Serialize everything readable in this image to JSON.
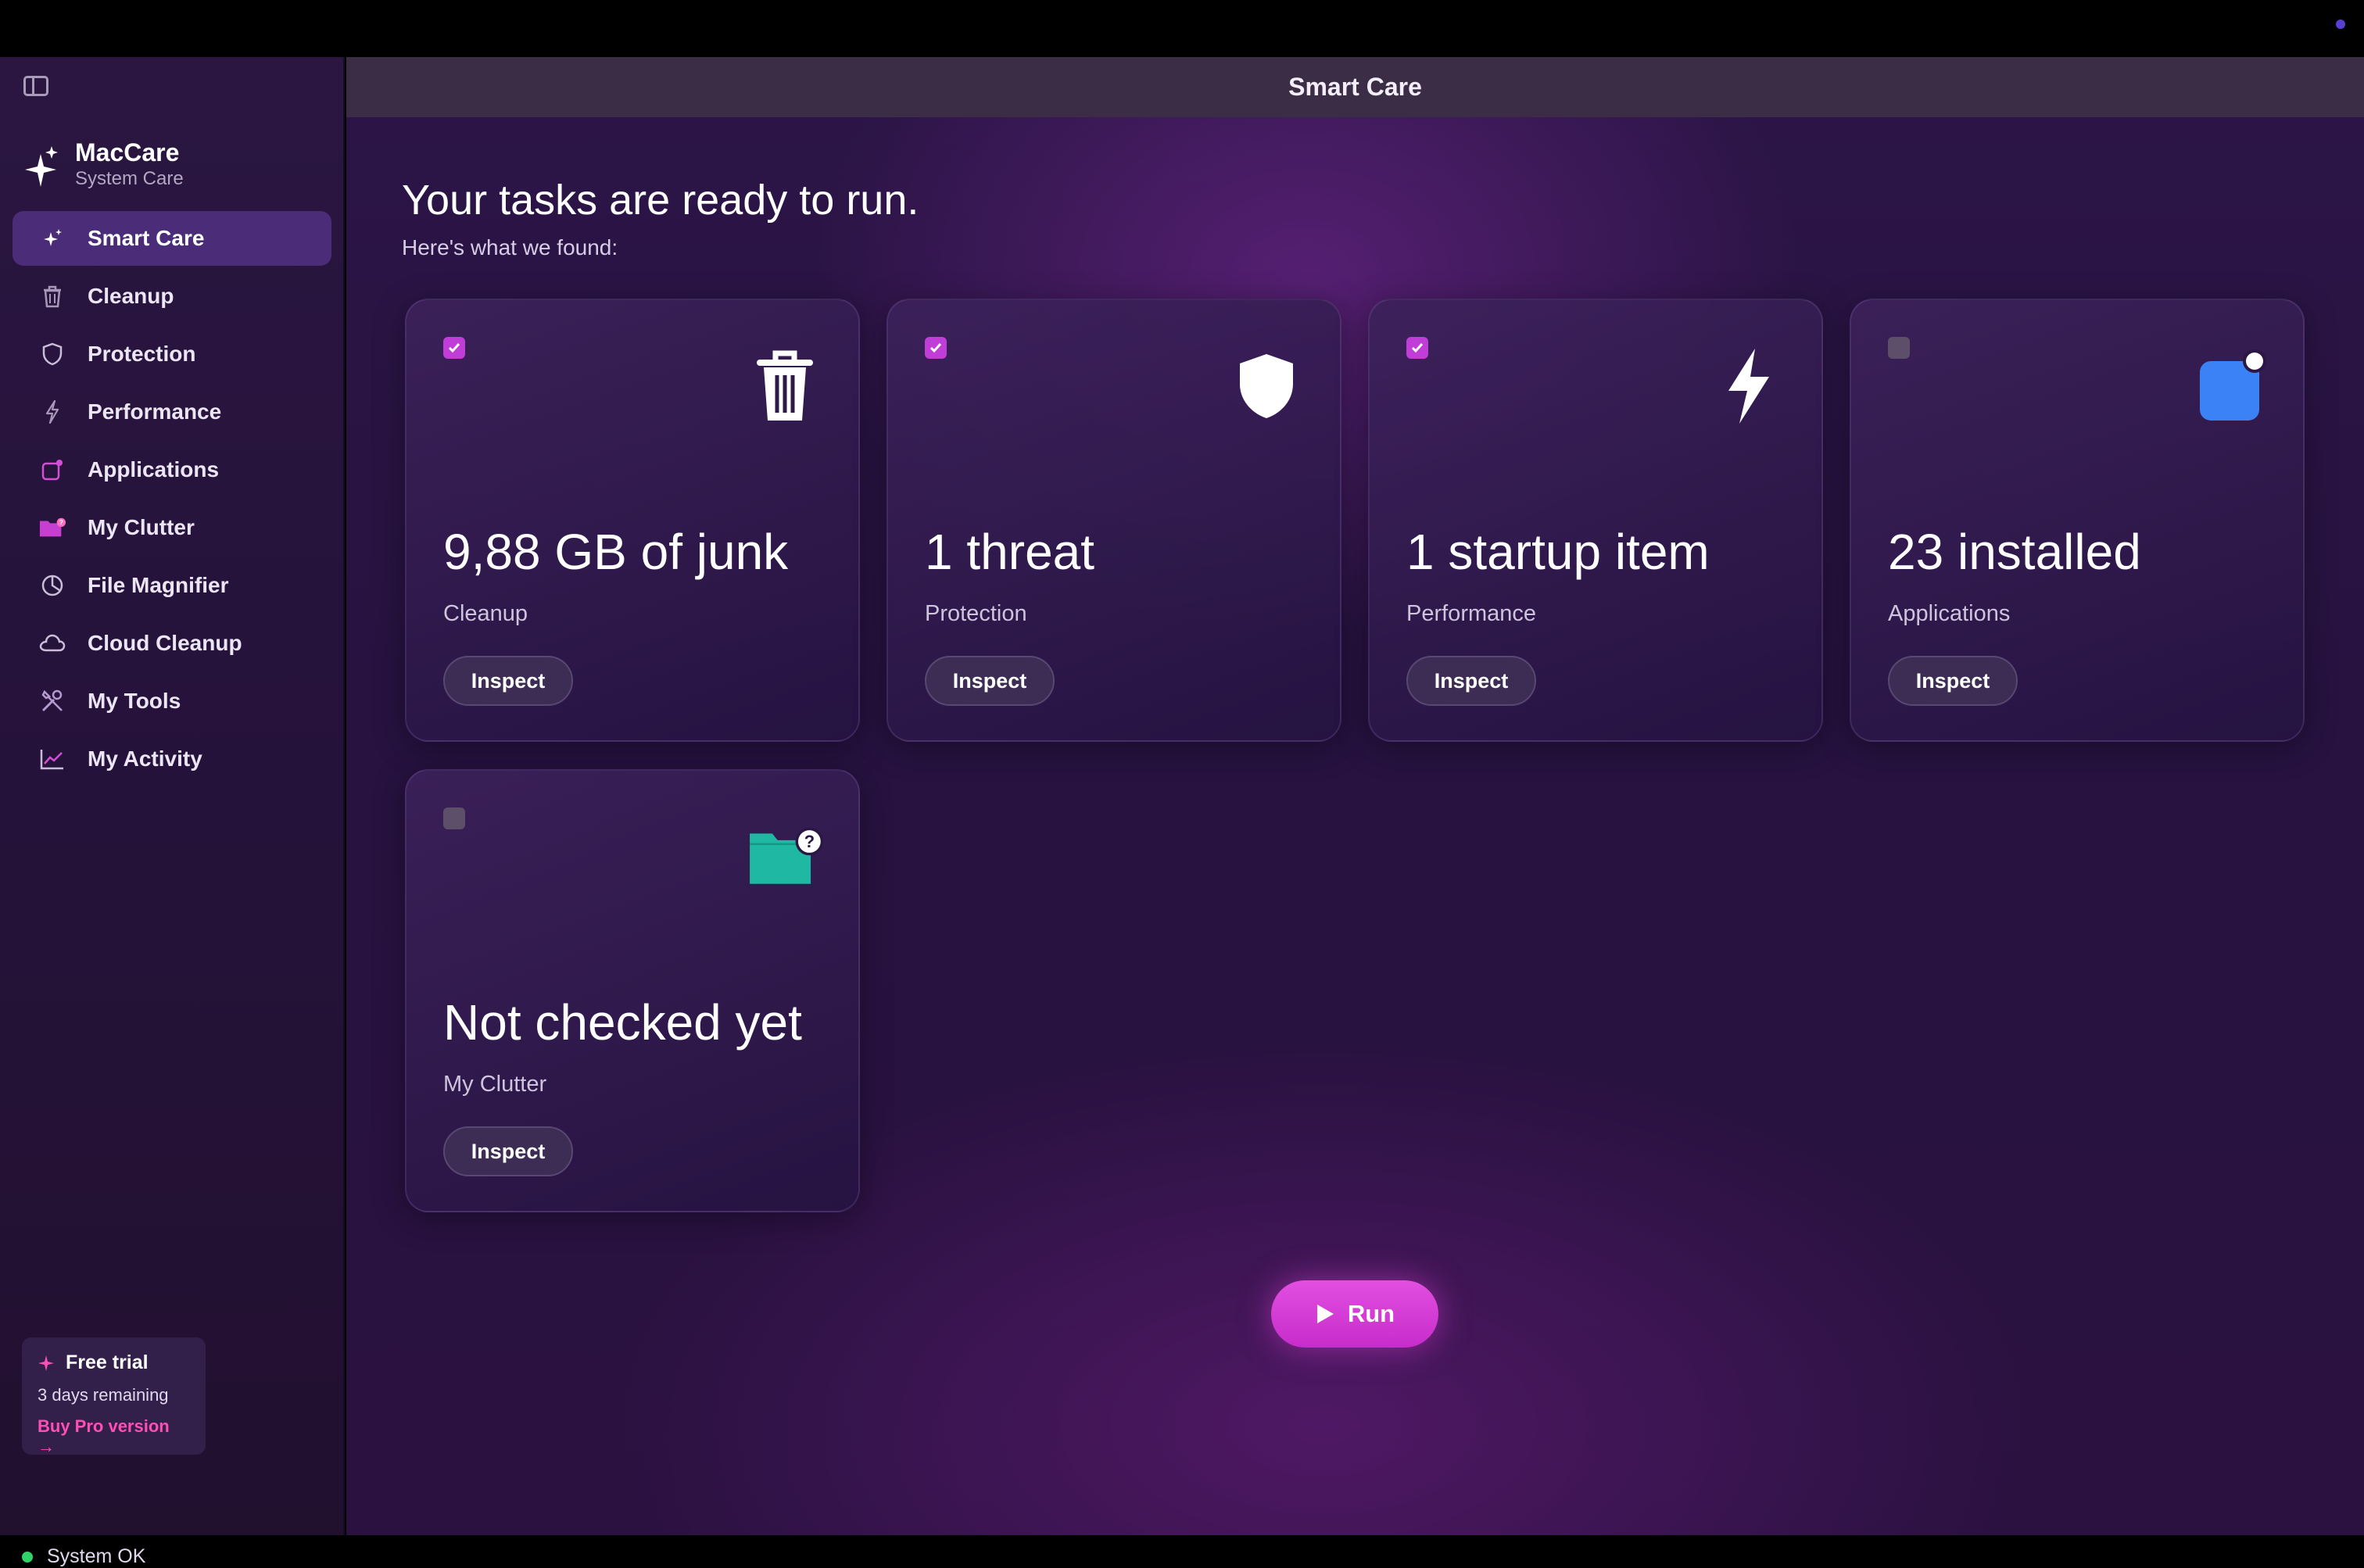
{
  "window": {
    "title": "Smart Care"
  },
  "brand": {
    "name": "MacCare",
    "subtitle": "System Care"
  },
  "sidebar": {
    "items": [
      {
        "label": "Smart Care",
        "icon": "sparkle-icon",
        "active": true
      },
      {
        "label": "Cleanup",
        "icon": "trash-icon"
      },
      {
        "label": "Protection",
        "icon": "shield-icon"
      },
      {
        "label": "Performance",
        "icon": "bolt-icon"
      },
      {
        "label": "Applications",
        "icon": "app-icon"
      },
      {
        "label": "My Clutter",
        "icon": "folder-icon"
      },
      {
        "label": "File Magnifier",
        "icon": "pie-icon"
      },
      {
        "label": "Cloud Cleanup",
        "icon": "cloud-icon"
      },
      {
        "label": "My Tools",
        "icon": "tools-icon"
      },
      {
        "label": "My Activity",
        "icon": "chart-icon"
      }
    ]
  },
  "trial": {
    "title": "Free trial",
    "remaining": "3 days remaining",
    "link": "Buy Pro version →"
  },
  "status": {
    "label": "System OK",
    "color": "#2fd36a"
  },
  "main": {
    "headline": "Your tasks are ready to run.",
    "subline": "Here's what we found:",
    "inspect_label": "Inspect",
    "run_label": "Run",
    "cards": [
      {
        "value": "9,88 GB of junk",
        "label": "Cleanup",
        "checked": true,
        "icon": "trash-icon"
      },
      {
        "value": "1 threat",
        "label": "Protection",
        "checked": true,
        "icon": "shield-icon"
      },
      {
        "value": "1 startup item",
        "label": "Performance",
        "checked": true,
        "icon": "bolt-icon"
      },
      {
        "value": "23 installed",
        "label": "Applications",
        "checked": false,
        "icon": "app-badge-icon"
      },
      {
        "value": "Not checked yet",
        "label": "My Clutter",
        "checked": false,
        "icon": "folder-question-icon"
      }
    ]
  },
  "colors": {
    "accent": "#c03dd8",
    "run_button": "#d43fd6",
    "trial_link": "#ff4fb6",
    "applications_icon": "#3b82f6",
    "clutter_icon": "#1fb8a2"
  }
}
